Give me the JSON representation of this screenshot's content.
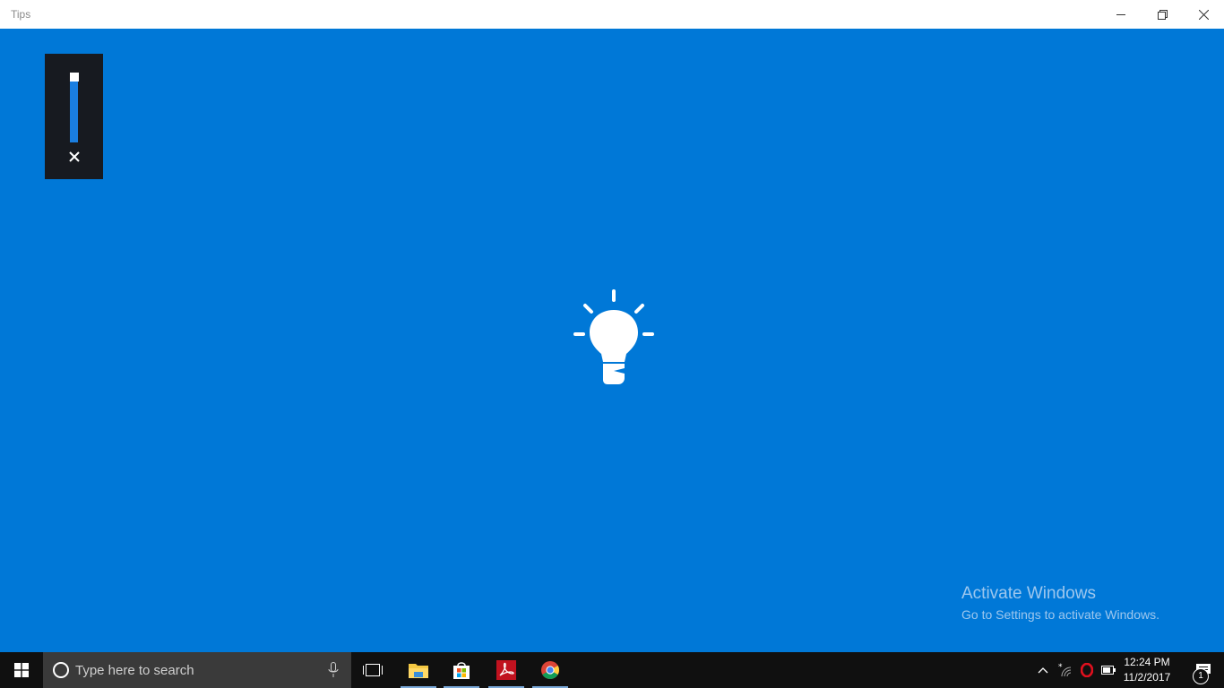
{
  "window": {
    "title": "Tips",
    "controls": [
      "minimize",
      "restore",
      "close"
    ]
  },
  "volume_flyout": {
    "level_percent": 100,
    "close_icon": "close-icon"
  },
  "main": {
    "loading_icon": "lightbulb-icon",
    "background_color": "#0078d7"
  },
  "watermark": {
    "title": "Activate Windows",
    "subtitle": "Go to Settings to activate Windows."
  },
  "taskbar": {
    "search_placeholder": "Type here to search",
    "pinned": [
      {
        "name": "task-view",
        "icon": "task-view-icon",
        "active": false
      },
      {
        "name": "file-explorer",
        "icon": "folder-icon",
        "active": true
      },
      {
        "name": "store",
        "icon": "store-icon",
        "active": true
      },
      {
        "name": "acrobat",
        "icon": "acrobat-icon",
        "active": true
      },
      {
        "name": "chrome",
        "icon": "chrome-icon",
        "active": true
      }
    ],
    "tray": {
      "time": "12:24 PM",
      "date": "11/2/2017",
      "notification_count": "1"
    }
  }
}
